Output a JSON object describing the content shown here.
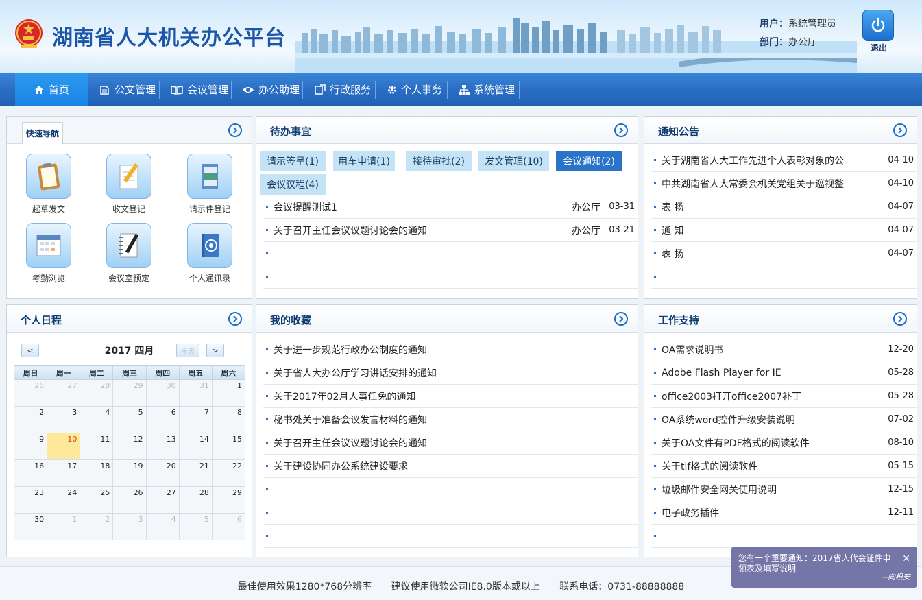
{
  "header": {
    "site_title": "湖南省人大机关办公平台",
    "user_label": "用户：",
    "user_name": "系统管理员",
    "dept_label": "部门：",
    "dept_name": "办公厅",
    "logout_label": "退出"
  },
  "nav": {
    "items": [
      {
        "label": "首页",
        "icon": "home-icon"
      },
      {
        "label": "公文管理",
        "icon": "document-icon"
      },
      {
        "label": "会议管理",
        "icon": "book-icon"
      },
      {
        "label": "办公助理",
        "icon": "eye-icon"
      },
      {
        "label": "行政服务",
        "icon": "service-icon"
      },
      {
        "label": "个人事务",
        "icon": "gear-icon"
      },
      {
        "label": "系统管理",
        "icon": "org-icon"
      }
    ]
  },
  "quick_nav": {
    "tab": "快速导航",
    "items": [
      {
        "label": "起草发文",
        "icon": "clipboard-icon"
      },
      {
        "label": "收文登记",
        "icon": "pencil-doc-icon"
      },
      {
        "label": "请示件登记",
        "icon": "binder-icon"
      },
      {
        "label": "考勤浏览",
        "icon": "calendar-icon"
      },
      {
        "label": "会议室预定",
        "icon": "notebook-icon"
      },
      {
        "label": "个人通讯录",
        "icon": "address-book-icon"
      }
    ]
  },
  "todo": {
    "title": "待办事宜",
    "tabs": [
      {
        "label": "请示签呈(1)"
      },
      {
        "label": "用车申请(1)"
      },
      {
        "label": "接待审批(2)"
      },
      {
        "label": "发文管理(10)"
      },
      {
        "label": "会议通知(2)"
      },
      {
        "label": "会议议程(4)"
      }
    ],
    "rows": [
      {
        "text": "会议提醒测试1",
        "dept": "办公厅",
        "date": "03-31"
      },
      {
        "text": "关于召开主任会议议题讨论会的通知",
        "dept": "办公厅",
        "date": "03-21"
      }
    ]
  },
  "notices": {
    "title": "通知公告",
    "rows": [
      {
        "text": "关于湖南省人大工作先进个人表彰对象的公",
        "date": "04-10"
      },
      {
        "text": "中共湖南省人大常委会机关党组关于巡视整",
        "date": "04-10"
      },
      {
        "text": "表 扬",
        "date": "04-07"
      },
      {
        "text": "通 知",
        "date": "04-07"
      },
      {
        "text": "表 扬",
        "date": "04-07"
      }
    ]
  },
  "schedule": {
    "title": "个人日程",
    "month_title": "2017 四月",
    "prev": "<",
    "next": ">",
    "today": "今天",
    "weekdays": [
      "周日",
      "周一",
      "周二",
      "周三",
      "周四",
      "周五",
      "周六"
    ],
    "weeks": [
      [
        "26",
        "27",
        "28",
        "29",
        "30",
        "31",
        "1"
      ],
      [
        "2",
        "3",
        "4",
        "5",
        "6",
        "7",
        "8"
      ],
      [
        "9",
        "10",
        "11",
        "12",
        "13",
        "14",
        "15"
      ],
      [
        "16",
        "17",
        "18",
        "19",
        "20",
        "21",
        "22"
      ],
      [
        "23",
        "24",
        "25",
        "26",
        "27",
        "28",
        "29"
      ],
      [
        "30",
        "1",
        "2",
        "3",
        "4",
        "5",
        "6"
      ]
    ]
  },
  "favorites": {
    "title": "我的收藏",
    "rows": [
      {
        "text": "关于进一步规范行政办公制度的通知"
      },
      {
        "text": "关于省人大办公厅学习讲话安排的通知"
      },
      {
        "text": "关于2017年02月人事任免的通知"
      },
      {
        "text": "秘书处关于准备会议发言材料的通知"
      },
      {
        "text": "关于召开主任会议议题讨论会的通知"
      },
      {
        "text": "关于建设协同办公系统建设要求"
      }
    ]
  },
  "support": {
    "title": "工作支持",
    "rows": [
      {
        "text": "OA需求说明书",
        "date": "12-20"
      },
      {
        "text": "Adobe Flash Player for IE",
        "date": "05-28"
      },
      {
        "text": "office2003打开office2007补丁",
        "date": "05-28"
      },
      {
        "text": "OA系统word控件升级安装说明",
        "date": "07-02"
      },
      {
        "text": "关于OA文件有PDF格式的阅读软件",
        "date": "08-10"
      },
      {
        "text": "关于tif格式的阅读软件",
        "date": "05-15"
      },
      {
        "text": "垃圾邮件安全网关使用说明",
        "date": "12-15"
      },
      {
        "text": "电子政务插件",
        "date": "12-11"
      }
    ]
  },
  "footer": {
    "resolution": "最佳使用效果1280*768分辨率",
    "browser": "建议使用微软公司IE8.0版本或以上",
    "phone": "联系电话：0731-88888888"
  },
  "notification": {
    "message": "您有一个重要通知：2017省人代会证件申领表及填写说明",
    "from": "--向根安"
  }
}
